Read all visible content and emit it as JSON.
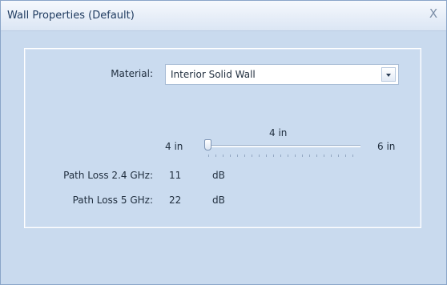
{
  "window": {
    "title": "Wall Properties (Default)",
    "close_glyph": "X"
  },
  "material": {
    "label": "Material:",
    "value": "Interior Solid Wall"
  },
  "thickness": {
    "current": "4 in",
    "min": "4 in",
    "max": "6 in",
    "slider_fraction": 0.0
  },
  "path_loss": [
    {
      "label": "Path Loss 2.4 GHz:",
      "value": "11",
      "unit": "dB"
    },
    {
      "label": "Path Loss 5 GHz:",
      "value": "22",
      "unit": "dB"
    }
  ],
  "icons": {
    "close": "close-icon",
    "dropdown": "chevron-down-icon"
  }
}
